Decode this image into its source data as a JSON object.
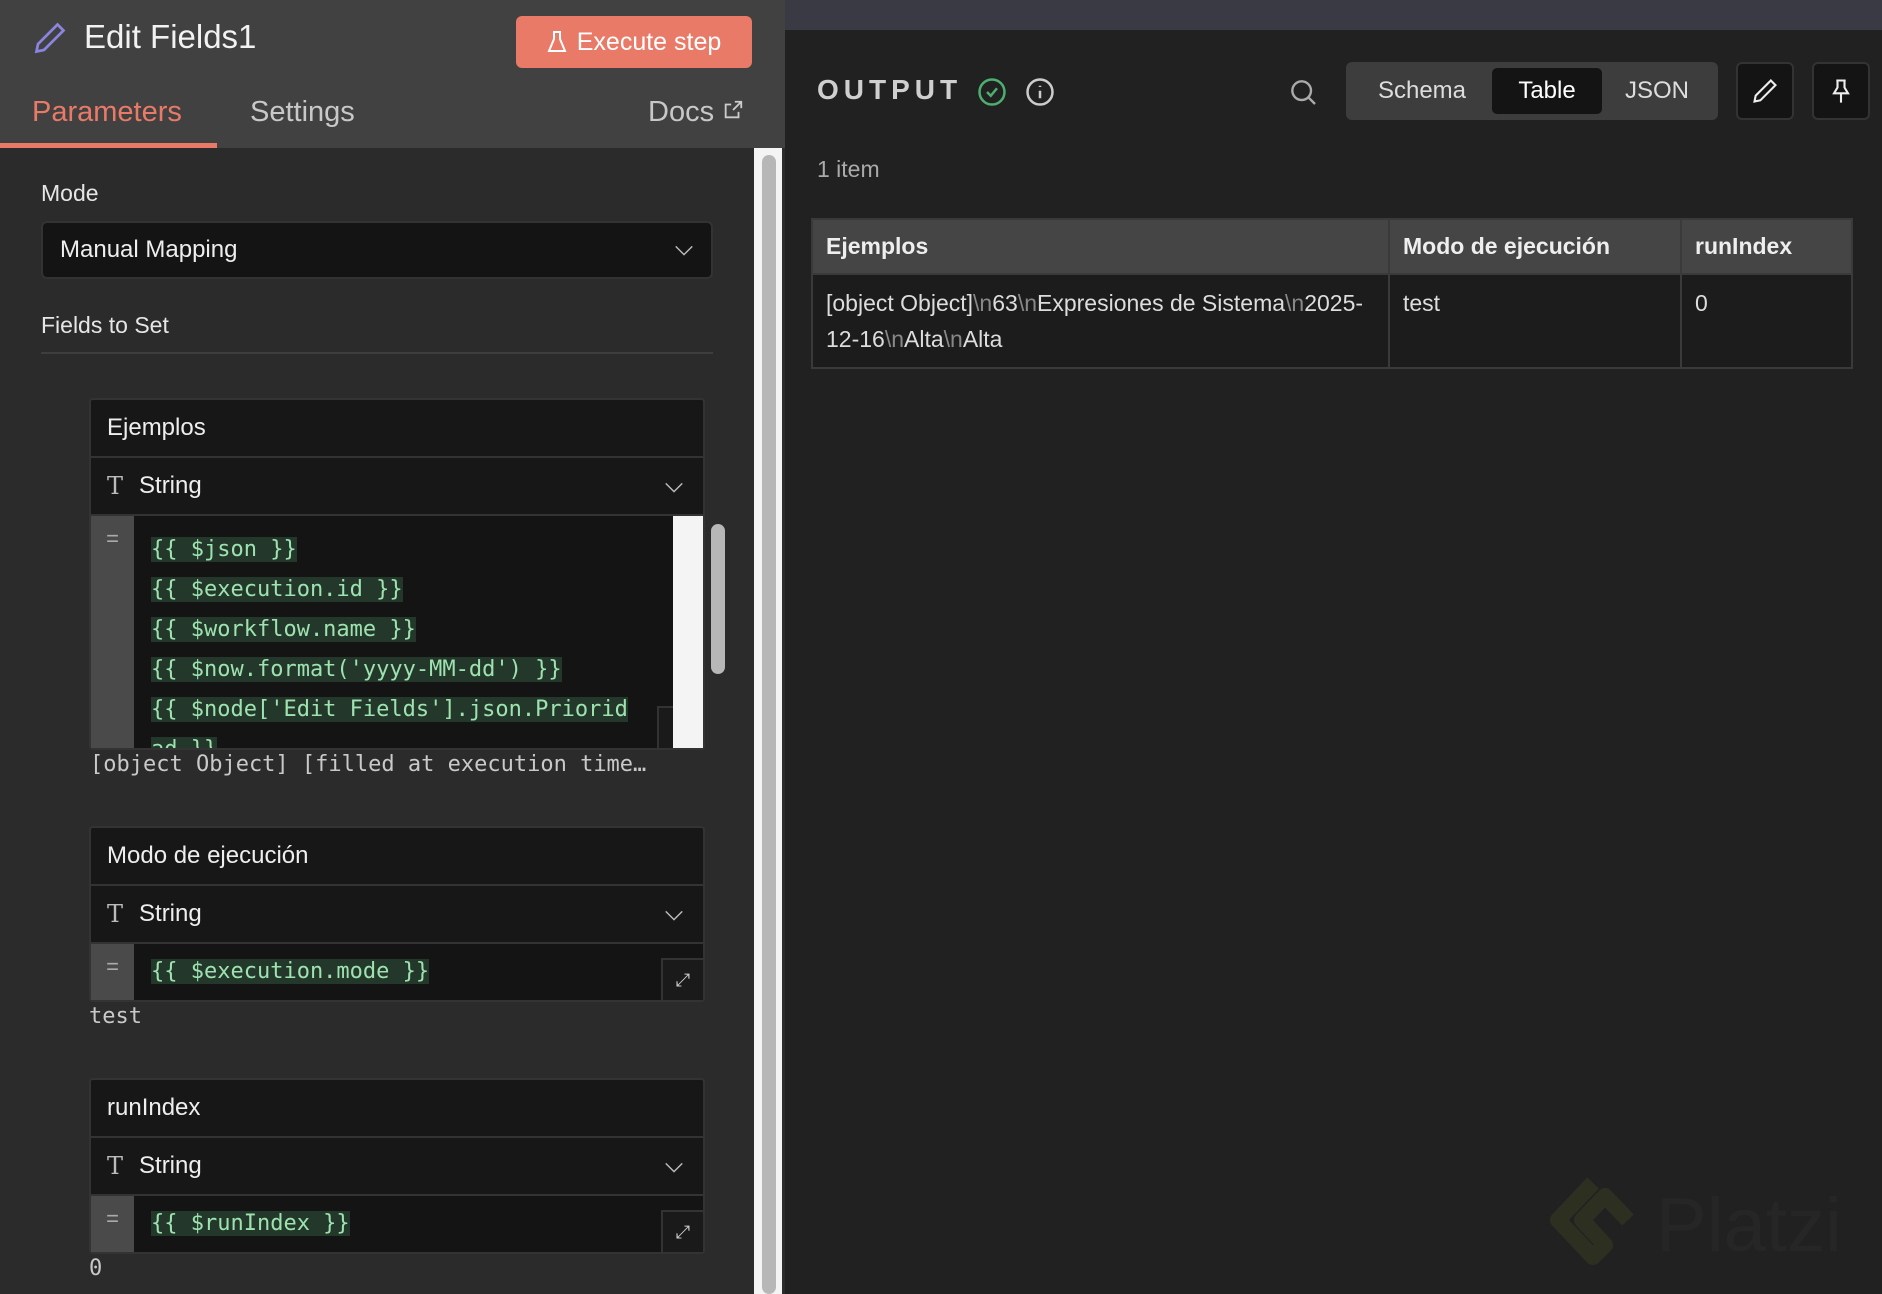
{
  "node": {
    "title": "Edit Fields1",
    "execute_label": "Execute step",
    "tabs": [
      "Parameters",
      "Settings"
    ],
    "docs_label": "Docs",
    "active_tab": "Parameters"
  },
  "params": {
    "mode_label": "Mode",
    "mode_value": "Manual Mapping",
    "fields_label": "Fields to Set",
    "fields": [
      {
        "name": "Ejemplos",
        "type": "String",
        "code": [
          "{{ $json }}",
          "{{ $execution.id }}",
          "{{ $workflow.name }}",
          "{{ $now.format('yyyy-MM-dd') }}",
          "{{ $node['Edit Fields'].json.Priorid",
          "ad }}"
        ],
        "result": "[object Object] [filled at execution time…"
      },
      {
        "name": "Modo de ejecución",
        "type": "String",
        "code": [
          "{{ $execution.mode }}"
        ],
        "result": "test"
      },
      {
        "name": "runIndex",
        "type": "String",
        "code": [
          "{{ $runIndex }}"
        ],
        "result": "0"
      }
    ]
  },
  "output": {
    "title": "OUTPUT",
    "views": [
      "Schema",
      "Table",
      "JSON"
    ],
    "active_view": "Table",
    "count": "1 item",
    "columns": [
      "Ejemplos",
      "Modo de ejecución",
      "runIndex"
    ],
    "rows": [
      {
        "ejemplos_parts": [
          "[object Object]",
          "63",
          "Expresiones de Sistema",
          "2025-12-16",
          "Alta",
          "Alta"
        ],
        "newline_token": "\\n",
        "modo": "test",
        "runIndex": "0"
      }
    ]
  },
  "watermark": "Platzi",
  "colors": {
    "accent": "#ea7a68",
    "success": "#4caf6e",
    "code": "#9ee2b0",
    "pencil": "#8b84e0"
  }
}
